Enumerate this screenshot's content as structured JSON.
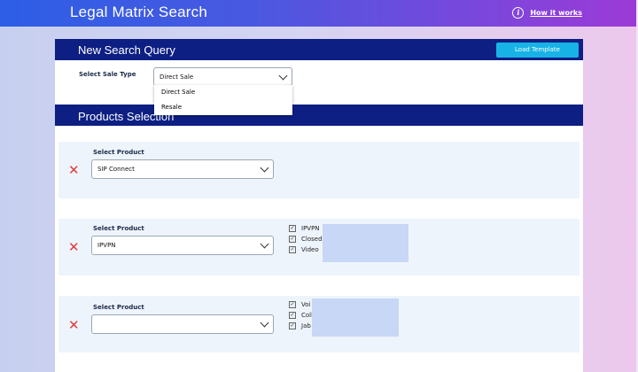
{
  "app": {
    "title": "Legal Matrix Search",
    "help_icon": "i",
    "help_label": "How it works"
  },
  "search_panel": {
    "title": "New Search Query",
    "load_template_label": "Load Template",
    "sale_type_label": "Select Sale Type",
    "sale_type_value": "Direct Sale",
    "sale_type_options": [
      "Direct Sale",
      "Resale"
    ]
  },
  "products_panel": {
    "title": "Products Selection"
  },
  "products": [
    {
      "label": "Select Product",
      "value": "SIP Connect",
      "remove_icon": "✕",
      "checks": []
    },
    {
      "label": "Select Product",
      "value": "IPVPN",
      "remove_icon": "✕",
      "checks": [
        "IPVPN",
        "Closed",
        "Video"
      ]
    },
    {
      "label": "Select Product",
      "value": "",
      "remove_icon": "✕",
      "checks": [
        "Voi",
        "Coll",
        "Jab"
      ]
    }
  ],
  "colors": {
    "header": "#0d1f83",
    "accent": "#17b3e6",
    "remove": "#e23b3b"
  }
}
